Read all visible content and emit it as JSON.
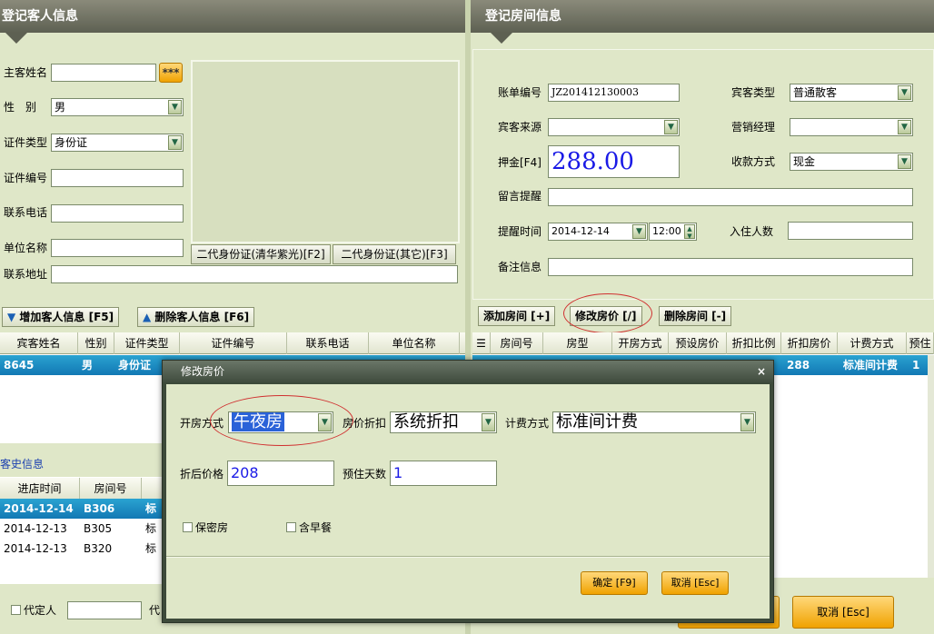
{
  "left_panel": {
    "title": "登记客人信息",
    "labels": {
      "name": "主客姓名",
      "gender": "性　别",
      "id_type": "证件类型",
      "id_no": "证件编号",
      "phone": "联系电话",
      "company": "单位名称",
      "address": "联系地址"
    },
    "values": {
      "name_btn": "***",
      "gender": "男",
      "id_type": "身份证"
    },
    "id_reader_buttons": [
      "二代身份证(清华紫光)[F2]",
      "二代身份证(其它)[F3]"
    ],
    "add_guest": "增加客人信息 [F5]",
    "del_guest": "删除客人信息 [F6]",
    "guest_columns": [
      "宾客姓名",
      "性别",
      "证件类型",
      "证件编号",
      "联系电话",
      "单位名称"
    ],
    "guest_rows": [
      {
        "name": "8645",
        "gender": "男",
        "id_type": "身份证"
      }
    ],
    "history_title": "客史信息",
    "history_columns": [
      "进店时间",
      "房间号"
    ],
    "history_rows": [
      {
        "time": "2014-12-14",
        "room": "B306",
        "extra": "标"
      },
      {
        "time": "2014-12-13",
        "room": "B305",
        "extra": "标"
      },
      {
        "time": "2014-12-13",
        "room": "B320",
        "extra": "标"
      }
    ],
    "agent_label": "代定人",
    "agent_label2": "代"
  },
  "right_panel": {
    "title": "登记房间信息",
    "labels": {
      "bill_no": "账单编号",
      "guest_type": "宾客类型",
      "source": "宾客来源",
      "sales_mgr": "营销经理",
      "deposit": "押金[F4]",
      "pay_method": "收款方式",
      "memo": "留言提醒",
      "remind_time": "提醒时间",
      "guest_count": "入住人数",
      "remark": "备注信息"
    },
    "values": {
      "bill_no": "JZ201412130003",
      "guest_type": "普通散客",
      "deposit": "288.00",
      "pay_method": "现金",
      "remind_date": "2014-12-14",
      "remind_clock": "12:00"
    },
    "add_room": "添加房间 [+]",
    "edit_price": "修改房价 [/]",
    "del_room": "删除房间 [-]",
    "room_columns": [
      "房间号",
      "房型",
      "开房方式",
      "预设房价",
      "折扣比例",
      "折扣房价",
      "计费方式",
      "预住"
    ],
    "room_row": {
      "disc_price": "288",
      "billing": "标准间计费",
      "days": "1"
    }
  },
  "bottom_buttons": {
    "cancel": "取消 [Esc]"
  },
  "dialog": {
    "title": "修改房价",
    "labels": {
      "open_mode": "开房方式",
      "discount": "房价折扣",
      "billing": "计费方式",
      "after_price": "折后价格",
      "days": "预住天数"
    },
    "values": {
      "open_mode": "午夜房",
      "discount": "系统折扣",
      "billing": "标准间计费",
      "after_price": "208",
      "days": "1"
    },
    "checkboxes": {
      "secret": "保密房",
      "breakfast": "含早餐"
    },
    "ok": "确定 [F9]",
    "cancel": "取消 [Esc]"
  },
  "colors": {
    "panel_bg": "#dfe7c8",
    "header": "#5d6052",
    "selection": "#1a8cc4",
    "button_orange": "#f0a200",
    "deposit_text": "#1a1ae6",
    "highlight_ring": "#d03030"
  }
}
